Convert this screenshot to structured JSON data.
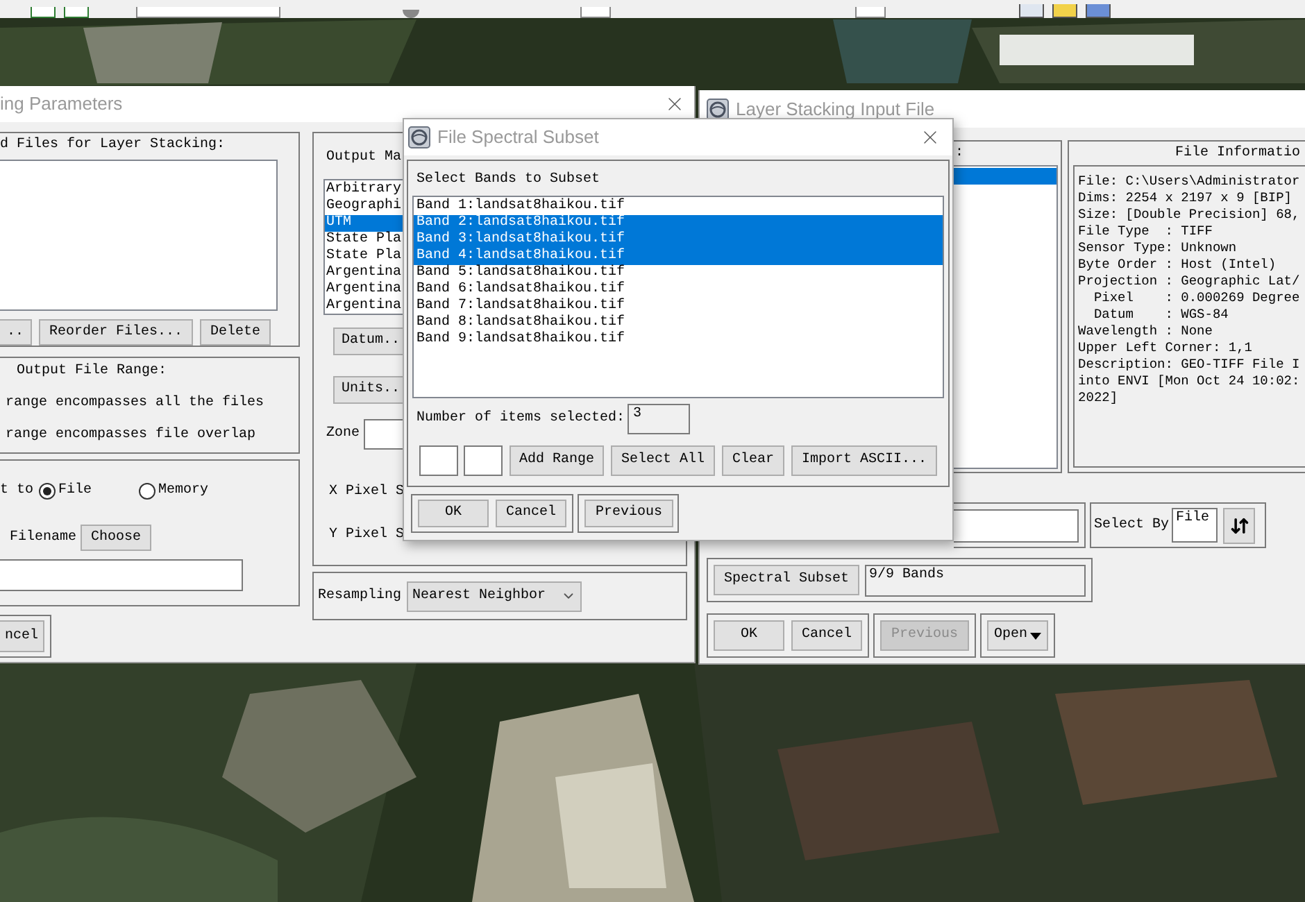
{
  "left_window": {
    "title": "ing Parameters",
    "files_label": "d Files for Layer Stacking:",
    "file_buttons": [
      "..",
      "Reorder Files...",
      "Delete"
    ],
    "range_title": "Output File Range:",
    "range_options": [
      "range encompasses all the files",
      "range encompasses file overlap"
    ],
    "output_label": "t to",
    "output_options": [
      {
        "label": "File",
        "selected": true
      },
      {
        "label": "Memory",
        "selected": false
      }
    ],
    "filename_label": "Filename",
    "choose_button": "Choose",
    "cancel_button": "ncel",
    "map_label": "Output Ma",
    "projections": [
      {
        "label": "Arbitrary",
        "selected": false
      },
      {
        "label": "Geographi",
        "selected": false
      },
      {
        "label": "UTM",
        "selected": true
      },
      {
        "label": "State Pla",
        "selected": false
      },
      {
        "label": "State Pla",
        "selected": false
      },
      {
        "label": "Argentina",
        "selected": false
      },
      {
        "label": "Argentina",
        "selected": false
      },
      {
        "label": "Argentina",
        "selected": false
      }
    ],
    "datum_button": "Datum..",
    "units_button": "Units..",
    "zone_label": "Zone",
    "x_pixel_label": "X Pixel S",
    "y_pixel_label": "Y Pixel S",
    "resampling_label": "Resampling",
    "resampling_value": "Nearest Neighbor"
  },
  "subset_window": {
    "title": "File Spectral Subset",
    "list_label": "Select Bands to Subset",
    "bands": [
      {
        "label": "Band 1:landsat8haikou.tif",
        "selected": false
      },
      {
        "label": "Band 2:landsat8haikou.tif",
        "selected": true
      },
      {
        "label": "Band 3:landsat8haikou.tif",
        "selected": true
      },
      {
        "label": "Band 4:landsat8haikou.tif",
        "selected": true
      },
      {
        "label": "Band 5:landsat8haikou.tif",
        "selected": false
      },
      {
        "label": "Band 6:landsat8haikou.tif",
        "selected": false
      },
      {
        "label": "Band 7:landsat8haikou.tif",
        "selected": false
      },
      {
        "label": "Band 8:landsat8haikou.tif",
        "selected": false
      },
      {
        "label": "Band 9:landsat8haikou.tif",
        "selected": false
      }
    ],
    "count_label": "Number of items selected:",
    "count_value": "3",
    "range_buttons": [
      "Add Range",
      "Select All",
      "Clear",
      "Import ASCII..."
    ],
    "ok_button": "OK",
    "cancel_button": "Cancel",
    "previous_button": "Previous"
  },
  "input_window": {
    "title": "Layer Stacking Input File",
    "list_label": ":",
    "file_rows": [
      {
        "selected": true
      }
    ],
    "info_title": "File Informatio",
    "info_lines": [
      "File: C:\\Users\\Administrator",
      "Dims: 2254 x 2197 x 9 [BIP]",
      "Size: [Double Precision] 68,",
      "File Type  : TIFF",
      "Sensor Type: Unknown",
      "Byte Order : Host (Intel)",
      "Projection : Geographic Lat/",
      "  Pixel    : 0.000269 Degree",
      "  Datum    : WGS-84",
      "Wavelength : None",
      "Upper Left Corner: 1,1",
      "Description: GEO-TIFF File I",
      "into ENVI [Mon Oct 24 10:02:",
      "2022]"
    ],
    "select_by_label": "Select By",
    "select_by_value": "File",
    "subset_button": "Spectral Subset",
    "subset_value": "9/9 Bands",
    "button_groups": [
      [
        {
          "label": "OK",
          "disabled": false,
          "kind": "push"
        },
        {
          "label": "Cancel",
          "disabled": false,
          "kind": "push"
        }
      ],
      [
        {
          "label": "Previous",
          "disabled": true,
          "kind": "push"
        }
      ],
      [
        {
          "label": "Open",
          "disabled": false,
          "kind": "menu"
        }
      ]
    ]
  }
}
